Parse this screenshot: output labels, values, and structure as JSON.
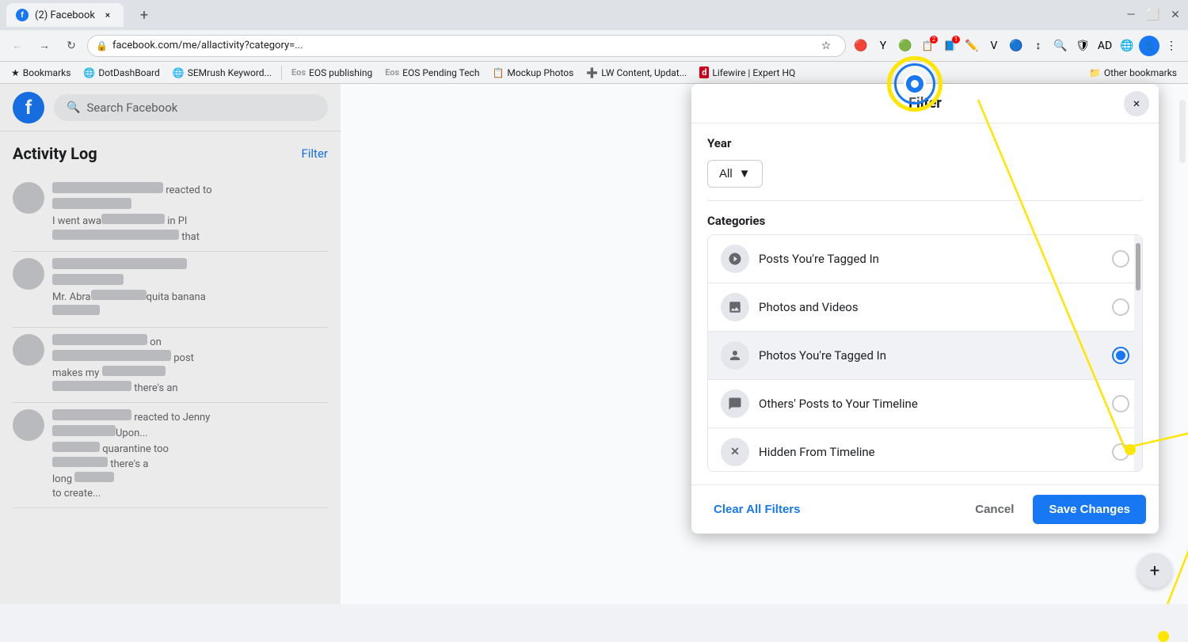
{
  "browser": {
    "tab_title": "(2) Facebook",
    "url": "facebook.com/me/allactivity?category=...",
    "nav_back": "←",
    "nav_forward": "→",
    "nav_refresh": "↻",
    "new_tab_btn": "+",
    "tab_close": "×",
    "bookmarks": [
      {
        "label": "Bookmarks",
        "icon": "★"
      },
      {
        "label": "DotDashBoard",
        "icon": "🌐"
      },
      {
        "label": "SEMrush Keyword...",
        "icon": "🌐"
      },
      {
        "label": "EOS publishing",
        "icon": "Eos"
      },
      {
        "label": "EOS Pending Tech",
        "icon": "Eos"
      },
      {
        "label": "Mockup Photos",
        "icon": "📋"
      },
      {
        "label": "LW Content, Updat...",
        "icon": "➕"
      },
      {
        "label": "Lifewire | Expert HQ",
        "icon": "d"
      },
      {
        "label": "Other bookmarks",
        "icon": "📁"
      }
    ]
  },
  "sidebar": {
    "search_placeholder": "Search Facebook",
    "activity_log_title": "Activity Log",
    "filter_link": "Filter"
  },
  "modal": {
    "title": "Filter",
    "close_btn": "×",
    "year_label": "Year",
    "year_value": "All",
    "categories_label": "Categories",
    "categories": [
      {
        "label": "Posts You're Tagged In",
        "icon": "🏷",
        "selected": false
      },
      {
        "label": "Photos and Videos",
        "icon": "🖼",
        "selected": false
      },
      {
        "label": "Photos You're Tagged In",
        "icon": "👤",
        "selected": true
      },
      {
        "label": "Others' Posts to Your Timeline",
        "icon": "💬",
        "selected": false
      },
      {
        "label": "Hidden From Timeline",
        "icon": "✕",
        "selected": false
      }
    ],
    "clear_btn": "Clear All Filters",
    "cancel_btn": "Cancel",
    "save_btn": "Save Changes"
  },
  "annotations": {
    "save_changes_label": "Save Changes"
  }
}
